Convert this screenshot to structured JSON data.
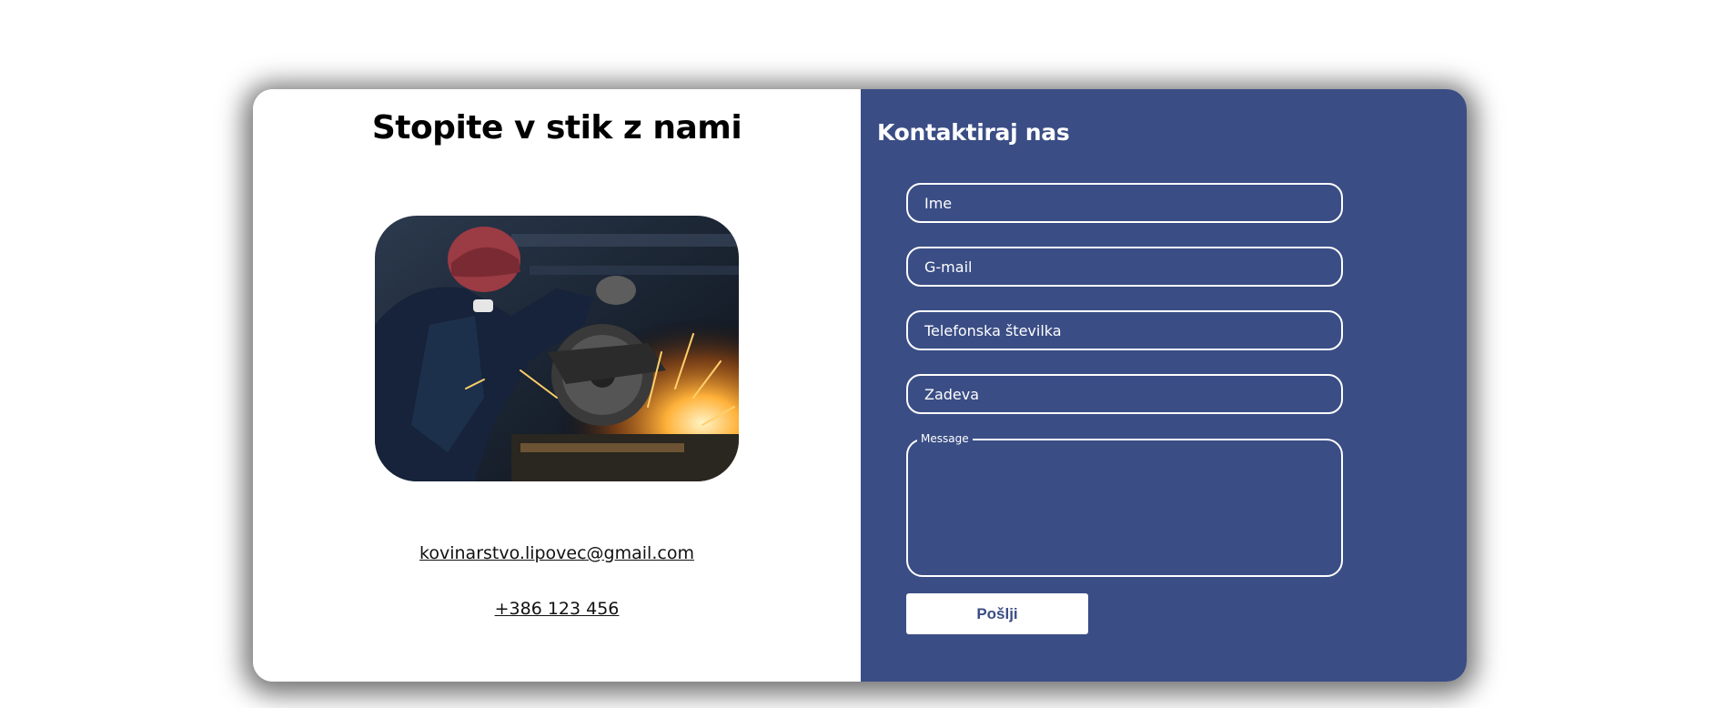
{
  "left_panel": {
    "title": "Stopite v stik z nami",
    "image_alt": "Welder grinding metal with sparks",
    "email": "kovinarstvo.lipovec@gmail.com",
    "phone": "+386 123 456"
  },
  "contact_form": {
    "title": "Kontaktiraj nas",
    "fields": {
      "name_placeholder": "Ime",
      "email_placeholder": "G-mail",
      "phone_placeholder": "Telefonska številka",
      "subject_placeholder": "Zadeva",
      "message_label": "Message"
    },
    "submit_label": "Pošlji"
  },
  "colors": {
    "panel_blue": "#3a4d85",
    "white": "#ffffff"
  }
}
